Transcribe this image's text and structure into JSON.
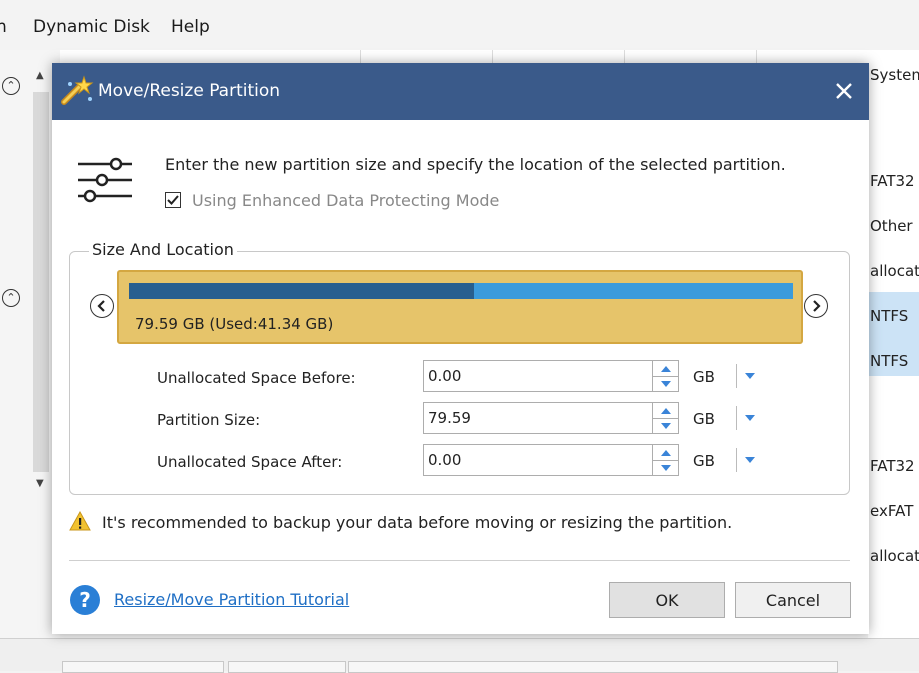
{
  "app": {
    "menu": [
      "n",
      "Dynamic Disk",
      "Help"
    ],
    "right_column_labels": [
      "System",
      "FAT32",
      "Other",
      "allocat",
      "NTFS",
      "NTFS",
      "FAT32",
      "exFAT",
      "allocat"
    ]
  },
  "dialog": {
    "title": "Move/Resize Partition",
    "description": "Enter the new partition size and specify the location of the selected partition.",
    "enhanced_mode": {
      "label": "Using Enhanced Data Protecting Mode",
      "checked": true
    },
    "section_title": "Size And Location",
    "partition": {
      "label": "79.59 GB (Used:41.34 GB)",
      "total_gb": 79.59,
      "used_gb": 41.34,
      "colors": {
        "block": "#e6c46a",
        "used": "#285f8f",
        "free": "#3b9bdc"
      }
    },
    "fields": [
      {
        "label": "Unallocated Space Before:",
        "value": "0.00",
        "unit": "GB"
      },
      {
        "label": "Partition Size:",
        "value": "79.59",
        "unit": "GB"
      },
      {
        "label": "Unallocated Space After:",
        "value": "0.00",
        "unit": "GB"
      }
    ],
    "warning": "It's recommended to backup your data before moving or resizing the partition.",
    "tutorial_link": "Resize/Move Partition Tutorial",
    "ok_label": "OK",
    "cancel_label": "Cancel",
    "colors": {
      "titlebar": "#3a5a8a",
      "link": "#1f6fc5",
      "accent": "#1f6fc5"
    }
  }
}
